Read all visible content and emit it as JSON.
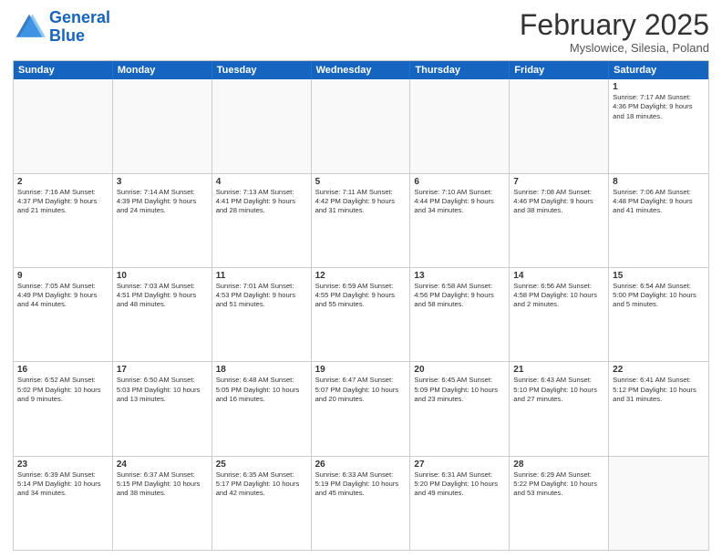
{
  "logo": {
    "line1": "General",
    "line2": "Blue"
  },
  "title": "February 2025",
  "location": "Myslowice, Silesia, Poland",
  "header_days": [
    "Sunday",
    "Monday",
    "Tuesday",
    "Wednesday",
    "Thursday",
    "Friday",
    "Saturday"
  ],
  "weeks": [
    [
      {
        "day": "",
        "info": ""
      },
      {
        "day": "",
        "info": ""
      },
      {
        "day": "",
        "info": ""
      },
      {
        "day": "",
        "info": ""
      },
      {
        "day": "",
        "info": ""
      },
      {
        "day": "",
        "info": ""
      },
      {
        "day": "1",
        "info": "Sunrise: 7:17 AM\nSunset: 4:36 PM\nDaylight: 9 hours\nand 18 minutes."
      }
    ],
    [
      {
        "day": "2",
        "info": "Sunrise: 7:16 AM\nSunset: 4:37 PM\nDaylight: 9 hours\nand 21 minutes."
      },
      {
        "day": "3",
        "info": "Sunrise: 7:14 AM\nSunset: 4:39 PM\nDaylight: 9 hours\nand 24 minutes."
      },
      {
        "day": "4",
        "info": "Sunrise: 7:13 AM\nSunset: 4:41 PM\nDaylight: 9 hours\nand 28 minutes."
      },
      {
        "day": "5",
        "info": "Sunrise: 7:11 AM\nSunset: 4:42 PM\nDaylight: 9 hours\nand 31 minutes."
      },
      {
        "day": "6",
        "info": "Sunrise: 7:10 AM\nSunset: 4:44 PM\nDaylight: 9 hours\nand 34 minutes."
      },
      {
        "day": "7",
        "info": "Sunrise: 7:08 AM\nSunset: 4:46 PM\nDaylight: 9 hours\nand 38 minutes."
      },
      {
        "day": "8",
        "info": "Sunrise: 7:06 AM\nSunset: 4:48 PM\nDaylight: 9 hours\nand 41 minutes."
      }
    ],
    [
      {
        "day": "9",
        "info": "Sunrise: 7:05 AM\nSunset: 4:49 PM\nDaylight: 9 hours\nand 44 minutes."
      },
      {
        "day": "10",
        "info": "Sunrise: 7:03 AM\nSunset: 4:51 PM\nDaylight: 9 hours\nand 48 minutes."
      },
      {
        "day": "11",
        "info": "Sunrise: 7:01 AM\nSunset: 4:53 PM\nDaylight: 9 hours\nand 51 minutes."
      },
      {
        "day": "12",
        "info": "Sunrise: 6:59 AM\nSunset: 4:55 PM\nDaylight: 9 hours\nand 55 minutes."
      },
      {
        "day": "13",
        "info": "Sunrise: 6:58 AM\nSunset: 4:56 PM\nDaylight: 9 hours\nand 58 minutes."
      },
      {
        "day": "14",
        "info": "Sunrise: 6:56 AM\nSunset: 4:58 PM\nDaylight: 10 hours\nand 2 minutes."
      },
      {
        "day": "15",
        "info": "Sunrise: 6:54 AM\nSunset: 5:00 PM\nDaylight: 10 hours\nand 5 minutes."
      }
    ],
    [
      {
        "day": "16",
        "info": "Sunrise: 6:52 AM\nSunset: 5:02 PM\nDaylight: 10 hours\nand 9 minutes."
      },
      {
        "day": "17",
        "info": "Sunrise: 6:50 AM\nSunset: 5:03 PM\nDaylight: 10 hours\nand 13 minutes."
      },
      {
        "day": "18",
        "info": "Sunrise: 6:48 AM\nSunset: 5:05 PM\nDaylight: 10 hours\nand 16 minutes."
      },
      {
        "day": "19",
        "info": "Sunrise: 6:47 AM\nSunset: 5:07 PM\nDaylight: 10 hours\nand 20 minutes."
      },
      {
        "day": "20",
        "info": "Sunrise: 6:45 AM\nSunset: 5:09 PM\nDaylight: 10 hours\nand 23 minutes."
      },
      {
        "day": "21",
        "info": "Sunrise: 6:43 AM\nSunset: 5:10 PM\nDaylight: 10 hours\nand 27 minutes."
      },
      {
        "day": "22",
        "info": "Sunrise: 6:41 AM\nSunset: 5:12 PM\nDaylight: 10 hours\nand 31 minutes."
      }
    ],
    [
      {
        "day": "23",
        "info": "Sunrise: 6:39 AM\nSunset: 5:14 PM\nDaylight: 10 hours\nand 34 minutes."
      },
      {
        "day": "24",
        "info": "Sunrise: 6:37 AM\nSunset: 5:15 PM\nDaylight: 10 hours\nand 38 minutes."
      },
      {
        "day": "25",
        "info": "Sunrise: 6:35 AM\nSunset: 5:17 PM\nDaylight: 10 hours\nand 42 minutes."
      },
      {
        "day": "26",
        "info": "Sunrise: 6:33 AM\nSunset: 5:19 PM\nDaylight: 10 hours\nand 45 minutes."
      },
      {
        "day": "27",
        "info": "Sunrise: 6:31 AM\nSunset: 5:20 PM\nDaylight: 10 hours\nand 49 minutes."
      },
      {
        "day": "28",
        "info": "Sunrise: 6:29 AM\nSunset: 5:22 PM\nDaylight: 10 hours\nand 53 minutes."
      },
      {
        "day": "",
        "info": ""
      }
    ]
  ]
}
